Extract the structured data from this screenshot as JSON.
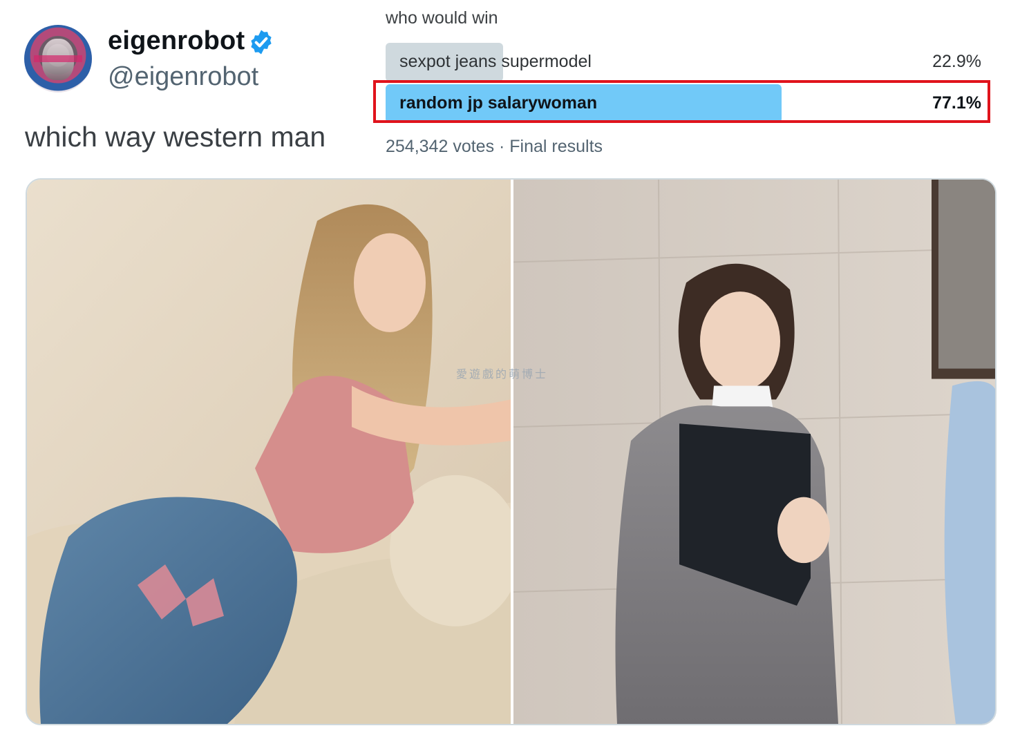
{
  "tweet": {
    "display_name": "eigenrobot",
    "handle": "@eigenrobot",
    "verified": true,
    "verified_icon": "verified-badge-icon",
    "text": "which way western man"
  },
  "poll": {
    "question": "who would win",
    "options": [
      {
        "label": "sexpot jeans supermodel",
        "percent_text": "22.9%",
        "fraction": 0.229,
        "winner": false
      },
      {
        "label": "random jp salarywoman",
        "percent_text": "77.1%",
        "fraction": 0.771,
        "winner": true
      }
    ],
    "meta": "254,342 votes · Final results"
  },
  "media": {
    "left_photo": "jeans-model-photo",
    "right_photo": "office-worker-photo"
  },
  "watermark": "愛遊戲的萌博士",
  "colors": {
    "winner_bar": "#71c9f8",
    "loser_bar": "#cfd9de",
    "highlight": "#e0131c",
    "verified": "#1d9bf0"
  }
}
